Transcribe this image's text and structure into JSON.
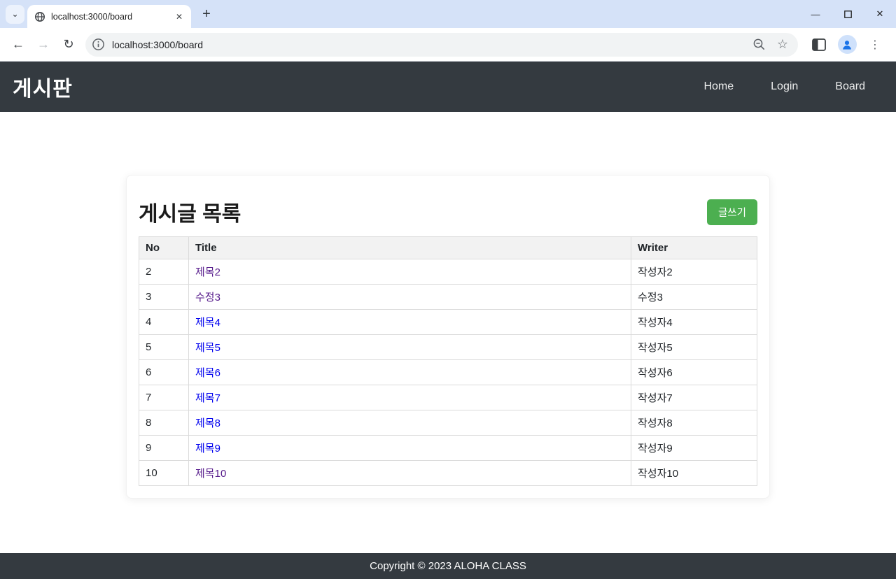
{
  "colors": {
    "accent_green": "#4caf50",
    "navbar_bg": "#343a40",
    "link_unvisited": "#0000ee",
    "link_visited": "#551a8b",
    "tabstrip_bg": "#d5e2f8",
    "omnibox_bg": "#f1f3f4"
  },
  "browser": {
    "tab_title": "localhost:3000/board",
    "url": "localhost:3000/board",
    "glyphs": {
      "tab_search_chevron": "⌄",
      "tab_close": "✕",
      "new_tab": "+",
      "minimize": "—",
      "window_close": "✕",
      "back": "←",
      "forward": "→",
      "reload": "↻",
      "bookmark_star": "☆",
      "menu_dots": "⋮"
    }
  },
  "navbar": {
    "brand": "게시판",
    "links": [
      {
        "label": "Home"
      },
      {
        "label": "Login"
      },
      {
        "label": "Board"
      }
    ]
  },
  "board": {
    "heading": "게시글 목록",
    "write_button": "글쓰기",
    "table": {
      "headers": [
        "No",
        "Title",
        "Writer"
      ],
      "rows": [
        {
          "no": "2",
          "title": "제목2",
          "writer": "작성자2",
          "visited": true
        },
        {
          "no": "3",
          "title": "수정3",
          "writer": "수정3",
          "visited": true
        },
        {
          "no": "4",
          "title": "제목4",
          "writer": "작성자4",
          "visited": false
        },
        {
          "no": "5",
          "title": "제목5",
          "writer": "작성자5",
          "visited": false
        },
        {
          "no": "6",
          "title": "제목6",
          "writer": "작성자6",
          "visited": false
        },
        {
          "no": "7",
          "title": "제목7",
          "writer": "작성자7",
          "visited": false
        },
        {
          "no": "8",
          "title": "제목8",
          "writer": "작성자8",
          "visited": false
        },
        {
          "no": "9",
          "title": "제목9",
          "writer": "작성자9",
          "visited": false
        },
        {
          "no": "10",
          "title": "제목10",
          "writer": "작성자10",
          "visited": true
        }
      ]
    }
  },
  "footer": {
    "text": "Copyright © 2023 ALOHA CLASS"
  }
}
